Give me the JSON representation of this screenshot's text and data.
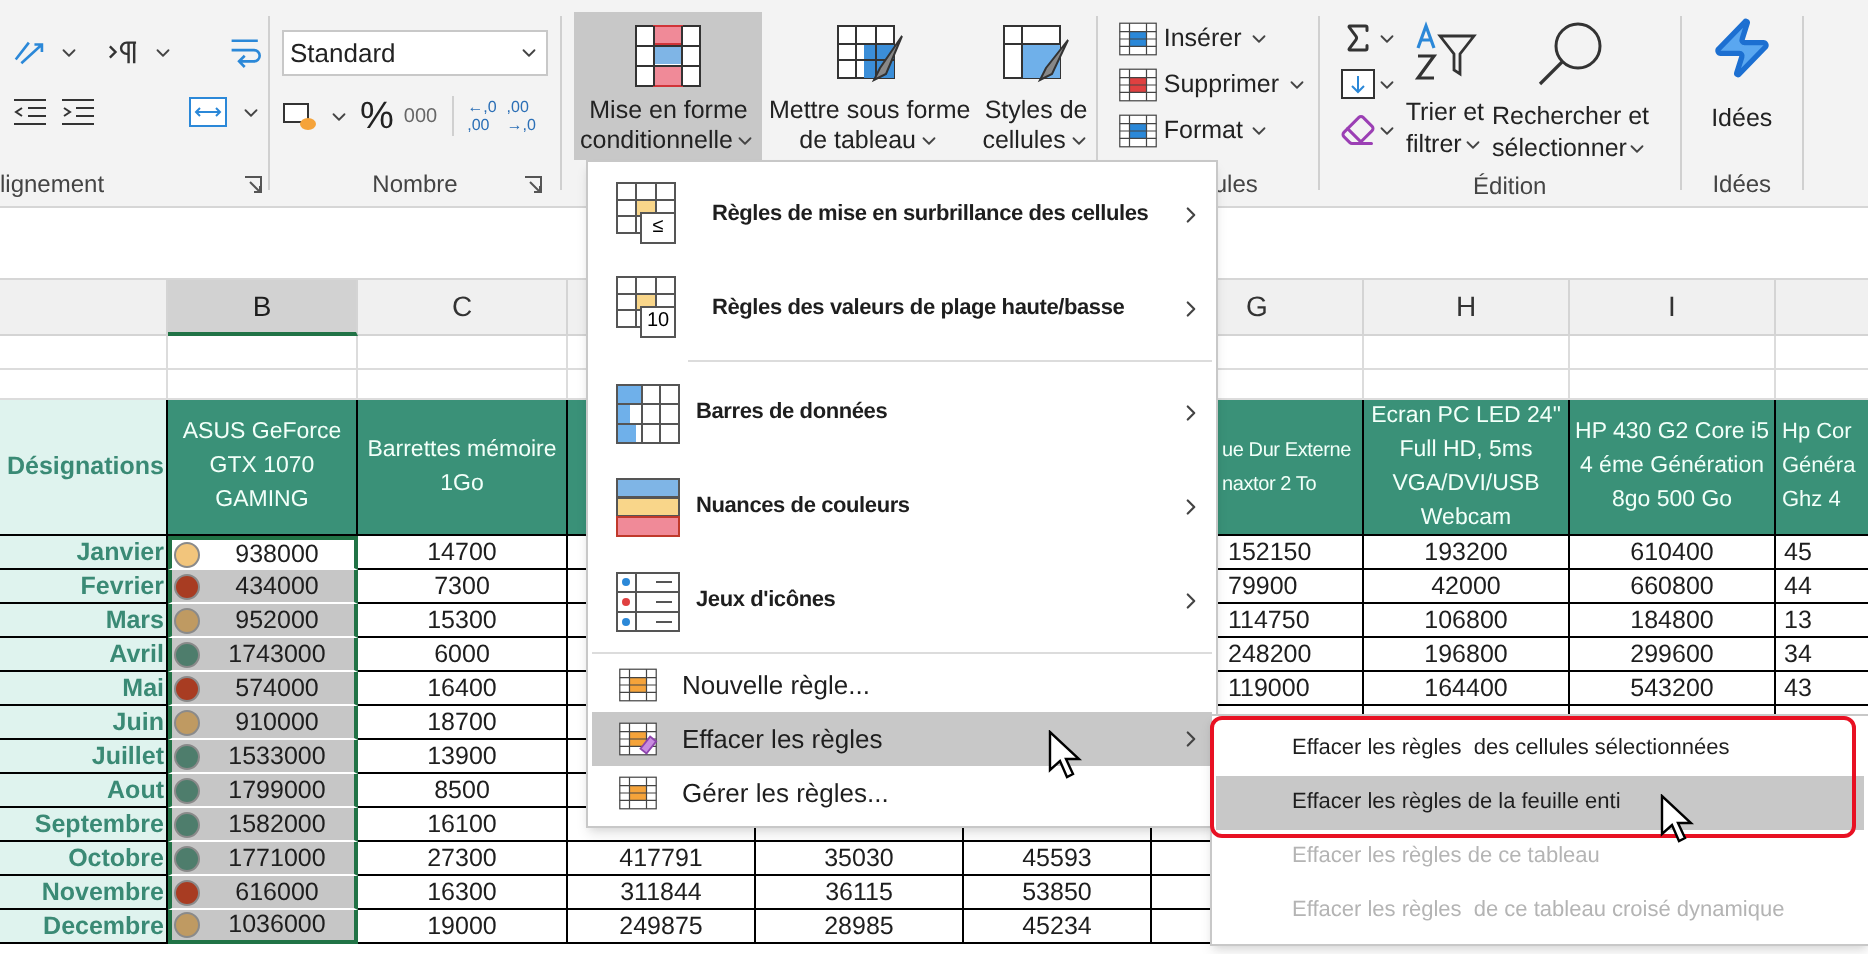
{
  "ribbon": {
    "alignment_group": {
      "label": "lignement"
    },
    "number_group": {
      "format_value": "Standard",
      "percent": "%",
      "thousands": "000",
      "decimal_buttons": [
        {
          "top": "←,0",
          "bottom": ",00"
        },
        {
          "top": ",00",
          "bottom": "→,0"
        }
      ],
      "label": "Nombre"
    },
    "style_buttons": [
      {
        "lines": [
          "Mise en forme",
          "conditionnelle"
        ],
        "selected": true
      },
      {
        "lines": [
          "Mettre sous forme",
          "de tableau"
        ],
        "selected": false
      },
      {
        "lines": [
          "Styles de",
          "cellules"
        ],
        "selected": false
      }
    ],
    "cells_group": {
      "items": [
        {
          "label": "Insérer"
        },
        {
          "label": "Supprimer"
        },
        {
          "label": "Format"
        }
      ],
      "label": "ules"
    },
    "editing_group": {
      "buttons": [
        {
          "lines": [
            "Trier et",
            "filtrer"
          ]
        },
        {
          "lines": [
            "Rechercher et",
            "sélectionner"
          ]
        }
      ],
      "label": "Édition"
    },
    "ideas_group": {
      "button": "Idées",
      "label": "Idées"
    }
  },
  "sheet": {
    "column_headers": {
      "B": {
        "label": "B",
        "selected": true
      },
      "C": {
        "label": "C",
        "selected": false
      },
      "G": {
        "label": "G",
        "selected": false
      },
      "H": {
        "label": "H",
        "selected": false
      },
      "I": {
        "label": "I",
        "selected": false
      }
    },
    "table_header": {
      "A": [
        "Désignations"
      ],
      "B": [
        "ASUS GeForce",
        "GTX 1070",
        "GAMING"
      ],
      "C": [
        "Barrettes mémoire",
        "1Go"
      ],
      "G": [
        "ue Dur Externe",
        "naxtor 2 To"
      ],
      "H": [
        "Ecran PC LED 24\"",
        "Full HD, 5ms",
        "VGA/DVI/USB",
        "Webcam"
      ],
      "I": [
        "HP 430 G2 Core i5",
        "4 éme Génération",
        "8go 500 Go"
      ],
      "J": [
        "Hp Cor",
        "Généra",
        "Ghz 4"
      ]
    },
    "rows": [
      {
        "label": "Janvier",
        "B": {
          "text": "938000",
          "color": "#f2c57c",
          "active": true
        },
        "C": "14700",
        "G": "152150",
        "H": "193200",
        "I": "610400",
        "J": "45"
      },
      {
        "label": "Fevrier",
        "B": {
          "text": "434000",
          "color": "#a83c22",
          "active": false
        },
        "C": "7300",
        "G": "79900",
        "H": "42000",
        "I": "660800",
        "J": "44"
      },
      {
        "label": "Mars",
        "B": {
          "text": "952000",
          "color": "#bf9a62",
          "active": false
        },
        "C": "15300",
        "G": "114750",
        "H": "106800",
        "I": "184800",
        "J": "13"
      },
      {
        "label": "Avril",
        "B": {
          "text": "1743000",
          "color": "#4e7d6c",
          "active": false
        },
        "C": "6000",
        "G": "248200",
        "H": "196800",
        "I": "299600",
        "J": "34"
      },
      {
        "label": "Mai",
        "B": {
          "text": "574000",
          "color": "#a83c22",
          "active": false
        },
        "C": "16400",
        "G": "119000",
        "H": "164400",
        "I": "543200",
        "J": "43"
      },
      {
        "label": "Juin",
        "B": {
          "text": "910000",
          "color": "#bf9a62",
          "active": false
        },
        "C": "18700"
      },
      {
        "label": "Juillet",
        "B": {
          "text": "1533000",
          "color": "#4e7d6c",
          "active": false
        },
        "C": "13900"
      },
      {
        "label": "Aout",
        "B": {
          "text": "1799000",
          "color": "#4e7d6c",
          "active": false
        },
        "C": "8500"
      },
      {
        "label": "Septembre",
        "B": {
          "text": "1582000",
          "color": "#4e7d6c",
          "active": false
        },
        "C": "16100"
      },
      {
        "label": "Octobre",
        "B": {
          "text": "1771000",
          "color": "#4e7d6c",
          "active": false
        },
        "C": "27300",
        "D": "417791",
        "E": "35030",
        "F": "45593"
      },
      {
        "label": "Novembre",
        "B": {
          "text": "616000",
          "color": "#a83c22",
          "active": false
        },
        "C": "16300",
        "D": "311844",
        "E": "36115",
        "F": "53850"
      },
      {
        "label": "Decembre",
        "B": {
          "text": "1036000",
          "color": "#bf9a62",
          "active": false
        },
        "C": "19000",
        "D": "249875",
        "E": "28985",
        "F": "45234"
      }
    ]
  },
  "conditional_menu": {
    "items": [
      {
        "kind": "large",
        "icon_text": "≤",
        "label": "Règles de mise en surbrillance des cellules",
        "submenu": true,
        "divider_above": false,
        "selected": false
      },
      {
        "kind": "large",
        "icon_text": "10",
        "label": "Règles des valeurs de plage haute/basse",
        "submenu": true,
        "divider_above": false,
        "selected": false
      },
      {
        "kind": "large",
        "label": "Barres de données",
        "submenu": true,
        "divider_above": true,
        "selected": false
      },
      {
        "kind": "large",
        "label": "Nuances de couleurs",
        "submenu": true,
        "divider_above": false,
        "selected": false
      },
      {
        "kind": "large",
        "label": "Jeux d'icônes",
        "submenu": true,
        "divider_above": false,
        "selected": false
      },
      {
        "kind": "small",
        "label": "Nouvelle règle...",
        "submenu": false,
        "divider_above": true,
        "selected": false
      },
      {
        "kind": "small",
        "label": "Effacer les règles",
        "submenu": true,
        "divider_above": false,
        "selected": true
      },
      {
        "kind": "small",
        "label": "Gérer les règles...",
        "submenu": false,
        "divider_above": false,
        "selected": false
      }
    ]
  },
  "clear_submenu": {
    "items": [
      {
        "label": "Effacer les règles  des cellules sélectionnées",
        "selected": false,
        "disabled": false
      },
      {
        "label": "Effacer les règles de la feuille enti",
        "selected": true,
        "disabled": false
      },
      {
        "label": "Effacer les règles de ce tableau",
        "selected": false,
        "disabled": true
      },
      {
        "label": "Effacer les règles  de ce tableau croisé dynamique",
        "selected": false,
        "disabled": true
      }
    ]
  }
}
